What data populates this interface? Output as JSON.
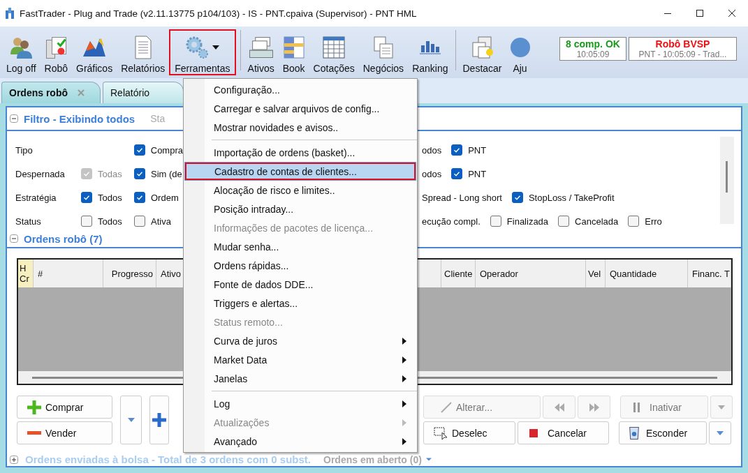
{
  "window": {
    "title": "FastTrader - Plug and Trade (v2.11.13775 p104/103) - IS - PNT.cpaiva (Supervisor) - PNT HML"
  },
  "toolbar": [
    {
      "label": "Log off",
      "highlighted": false,
      "dropdown": false
    },
    {
      "label": "Robô",
      "highlighted": false,
      "dropdown": false
    },
    {
      "label": "Gráficos",
      "highlighted": false,
      "dropdown": false
    },
    {
      "label": "Relatórios",
      "highlighted": false,
      "dropdown": false
    },
    {
      "label": "Ferramentas",
      "highlighted": true,
      "dropdown": true
    },
    {
      "kind": "separator"
    },
    {
      "label": "Ativos",
      "highlighted": false,
      "dropdown": false
    },
    {
      "label": "Book",
      "highlighted": false,
      "dropdown": false
    },
    {
      "label": "Cotações",
      "highlighted": false,
      "dropdown": false
    },
    {
      "label": "Negócios",
      "highlighted": false,
      "dropdown": false
    },
    {
      "label": "Ranking",
      "highlighted": false,
      "dropdown": false
    },
    {
      "kind": "separator"
    },
    {
      "label": "Destacar",
      "highlighted": false,
      "dropdown": false
    },
    {
      "label": "Aju",
      "highlighted": false,
      "dropdown": false
    }
  ],
  "status_boxes": [
    {
      "title": "8 comp. OK",
      "detail": "10:05:09",
      "color": "#1a9a1a"
    },
    {
      "title": "Robô BVSP",
      "detail": "PNT - 10:05:09 - Trad...",
      "color": "#ee1111"
    }
  ],
  "tabs": [
    {
      "label": "Ordens robô",
      "selected": true,
      "closable": true
    },
    {
      "label": "Relatório",
      "selected": false,
      "closable": false
    }
  ],
  "filter": {
    "title": "Filtro - Exibindo todos",
    "aside": "Sta",
    "rows": [
      {
        "label": "Tipo",
        "left": [
          {
            "kind": "none"
          },
          {
            "kind": "checkbox",
            "label": "Compra",
            "checked": true,
            "disabled": false
          }
        ],
        "right": [
          {
            "kind": "text",
            "label": "odos"
          },
          {
            "kind": "checkbox",
            "label": "PNT",
            "checked": true,
            "disabled": false
          }
        ]
      },
      {
        "label": "Despernada",
        "left": [
          {
            "kind": "checkbox",
            "label": "Todas",
            "checked": true,
            "disabled": true
          },
          {
            "kind": "checkbox",
            "label": "Sim (de",
            "checked": true,
            "disabled": false
          }
        ],
        "right": [
          {
            "kind": "text",
            "label": "odos"
          },
          {
            "kind": "checkbox",
            "label": "PNT",
            "checked": true,
            "disabled": false
          }
        ]
      },
      {
        "label": "Estratégia",
        "left": [
          {
            "kind": "checkbox",
            "label": "Todos",
            "checked": true,
            "disabled": false
          },
          {
            "kind": "checkbox",
            "label": "Ordem",
            "checked": true,
            "disabled": false
          }
        ],
        "right": [
          {
            "kind": "text",
            "label": "Spread - Long short"
          },
          {
            "kind": "checkbox",
            "label": "StopLoss / TakeProfit",
            "checked": true,
            "disabled": false
          }
        ]
      },
      {
        "label": "Status",
        "left": [
          {
            "kind": "checkbox",
            "label": "Todos",
            "checked": false,
            "disabled": false
          },
          {
            "kind": "checkbox",
            "label": "Ativa",
            "checked": false,
            "disabled": false
          }
        ],
        "right": [
          {
            "kind": "text",
            "label": "ecução compl."
          },
          {
            "kind": "checkbox",
            "label": "Finalizada",
            "checked": false,
            "disabled": false
          },
          {
            "kind": "checkbox",
            "label": "Cancelada",
            "checked": false,
            "disabled": false
          },
          {
            "kind": "checkbox",
            "label": "Erro",
            "checked": false,
            "disabled": false
          }
        ]
      }
    ]
  },
  "orders": {
    "title": "Ordens robô (7)",
    "left_columns": [
      "H Cr",
      "#",
      "Progresso",
      "Ativo"
    ],
    "right_columns": [
      "Cliente",
      "Operador",
      "Vel",
      "Quantidade",
      "Financ. T"
    ]
  },
  "buttons_left": [
    "Comprar",
    "Vender"
  ],
  "buttons_right": [
    [
      {
        "label": "Alterar...",
        "disabled": true
      },
      {
        "disabled": true
      },
      {
        "disabled": true
      },
      {
        "label": "Inativar",
        "disabled": true
      },
      {
        "disabled": true
      }
    ],
    [
      {
        "label": "Deselec",
        "disabled": false
      },
      {
        "label": "Cancelar",
        "disabled": false
      },
      {
        "label": "Esconder",
        "disabled": false
      },
      {
        "disabled": false
      }
    ]
  ],
  "footer": {
    "title": "Ordens enviadas à bolsa - Total de 3 ordens com 0 subst.",
    "dropdown": "Ordens em aberto (0)"
  },
  "menu": [
    {
      "label": "Configuração...",
      "disabled": false,
      "selected": false,
      "submenu": false
    },
    {
      "label": "Carregar e salvar arquivos de config...",
      "disabled": false,
      "selected": false,
      "submenu": false
    },
    {
      "label": "Mostrar novidades e avisos..",
      "disabled": false,
      "selected": false,
      "submenu": false
    },
    {
      "kind": "separator"
    },
    {
      "label": "Importação de ordens (basket)...",
      "disabled": false,
      "selected": false,
      "submenu": false
    },
    {
      "label": "Cadastro de contas de clientes...",
      "disabled": false,
      "selected": true,
      "submenu": false
    },
    {
      "label": "Alocação de risco e limites..",
      "disabled": false,
      "selected": false,
      "submenu": false
    },
    {
      "label": "Posição intraday...",
      "disabled": false,
      "selected": false,
      "submenu": false
    },
    {
      "label": "Informações de pacotes de licença...",
      "disabled": true,
      "selected": false,
      "submenu": false
    },
    {
      "label": "Mudar senha...",
      "disabled": false,
      "selected": false,
      "submenu": false
    },
    {
      "label": "Ordens rápidas...",
      "disabled": false,
      "selected": false,
      "submenu": false
    },
    {
      "label": "Fonte de dados DDE...",
      "disabled": false,
      "selected": false,
      "submenu": false
    },
    {
      "label": "Triggers e alertas...",
      "disabled": false,
      "selected": false,
      "submenu": false
    },
    {
      "label": "Status remoto...",
      "disabled": true,
      "selected": false,
      "submenu": false
    },
    {
      "label": "Curva de juros",
      "disabled": false,
      "selected": false,
      "submenu": true
    },
    {
      "label": "Market Data",
      "disabled": false,
      "selected": false,
      "submenu": true
    },
    {
      "label": "Janelas",
      "disabled": false,
      "selected": false,
      "submenu": true
    },
    {
      "kind": "separator"
    },
    {
      "label": "Log",
      "disabled": false,
      "selected": false,
      "submenu": true
    },
    {
      "label": "Atualizações",
      "disabled": true,
      "selected": false,
      "submenu": true
    },
    {
      "label": "Avançado",
      "disabled": false,
      "selected": false,
      "submenu": true
    }
  ]
}
